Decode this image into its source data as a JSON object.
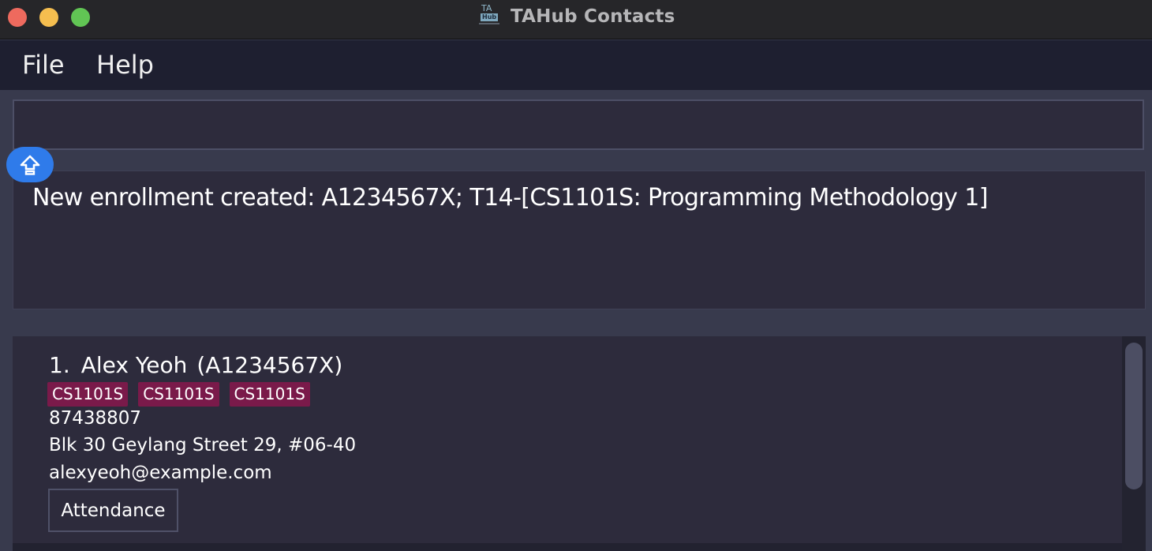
{
  "window": {
    "title": "TAHub Contacts",
    "app_icon": "tahub-contacts-logo"
  },
  "menu": {
    "file": "File",
    "help": "Help"
  },
  "command": {
    "value": "",
    "placeholder": ""
  },
  "result": {
    "message": "New enrollment created: A1234567X; T14-[CS1101S: Programming Methodology 1]"
  },
  "persons": [
    {
      "index": "1.",
      "name": "Alex Yeoh",
      "matric": "(A1234567X)",
      "tags": [
        "CS1101S",
        "CS1101S",
        "CS1101S"
      ],
      "phone": "87438807",
      "address": "Blk 30 Geylang Street 29, #06-40",
      "email": "alexyeoh@example.com",
      "attendance_label": "Attendance"
    }
  ],
  "colors": {
    "tag": "#7a1a4a",
    "upload_button": "#2f7bea",
    "background": "#383a4d",
    "panel": "#2d2b3c"
  }
}
